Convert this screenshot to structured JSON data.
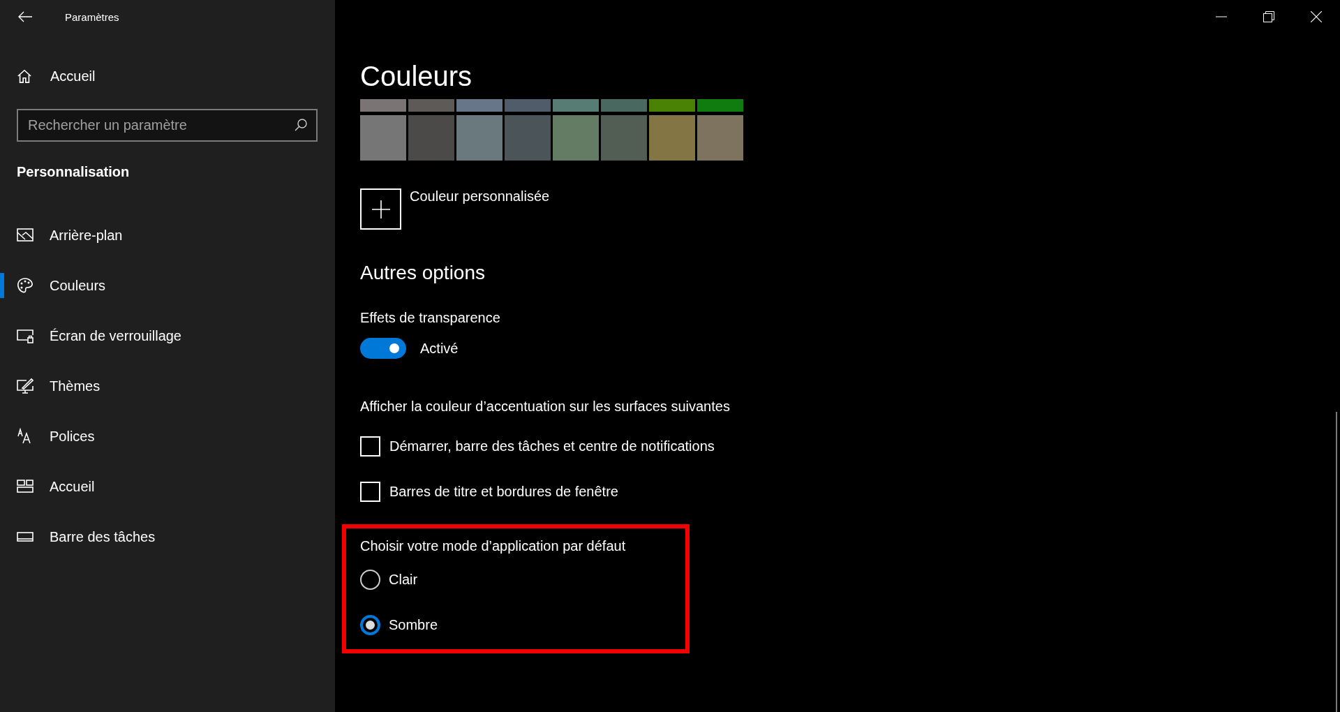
{
  "window": {
    "title": "Paramètres"
  },
  "sidebar": {
    "home": "Accueil",
    "search": {
      "placeholder": "Rechercher un paramètre"
    },
    "section": "Personnalisation",
    "items": [
      {
        "label": "Arrière-plan",
        "kind": "picture",
        "selected": false
      },
      {
        "label": "Couleurs",
        "kind": "palette",
        "selected": true
      },
      {
        "label": "Écran de verrouillage",
        "kind": "lockscreen",
        "selected": false
      },
      {
        "label": "Thèmes",
        "kind": "themes",
        "selected": false
      },
      {
        "label": "Polices",
        "kind": "fonts",
        "selected": false
      },
      {
        "label": "Accueil",
        "kind": "start",
        "selected": false
      },
      {
        "label": "Barre des tâches",
        "kind": "taskbar",
        "selected": false
      }
    ]
  },
  "main": {
    "title": "Couleurs",
    "swatches": [
      {
        "color": "#7a7574"
      },
      {
        "color": "#5d5a58"
      },
      {
        "color": "#68768a"
      },
      {
        "color": "#515c6b"
      },
      {
        "color": "#567c73"
      },
      {
        "color": "#486860"
      },
      {
        "color": "#498205"
      },
      {
        "color": "#107c10"
      },
      {
        "color": "#767676"
      },
      {
        "color": "#4c4a48"
      },
      {
        "color": "#69797e"
      },
      {
        "color": "#4a5459"
      },
      {
        "color": "#647c64"
      },
      {
        "color": "#525e54"
      },
      {
        "color": "#847545"
      },
      {
        "color": "#7e735f"
      }
    ],
    "custom_color": "Couleur personnalisée",
    "other_options": "Autres options",
    "transparency": {
      "label": "Effets de transparence",
      "on": true,
      "state": "Activé"
    },
    "accent_surfaces": {
      "heading": "Afficher la couleur d’accentuation sur les surfaces suivantes",
      "options": [
        {
          "label": "Démarrer, barre des tâches et centre de notifications",
          "checked": false
        },
        {
          "label": "Barres de titre et bordures de fenêtre",
          "checked": false
        }
      ]
    },
    "app_mode": {
      "heading": "Choisir votre mode d’application par défaut",
      "highlighted": true,
      "options": [
        {
          "label": "Clair",
          "selected": false
        },
        {
          "label": "Sombre",
          "selected": true
        }
      ]
    }
  }
}
